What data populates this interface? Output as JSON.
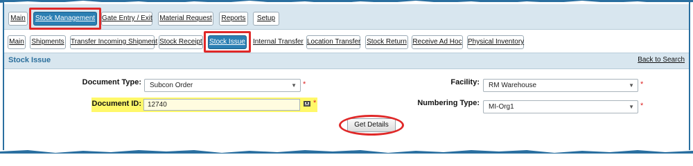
{
  "main_tabs": [
    {
      "label": "Main"
    },
    {
      "label": "Stock Management"
    },
    {
      "label": "Gate Entry / Exit"
    },
    {
      "label": "Material Request"
    },
    {
      "label": "Reports"
    },
    {
      "label": "Setup"
    }
  ],
  "sub_tabs": [
    {
      "label": "Main"
    },
    {
      "label": "Shipments"
    },
    {
      "label": "Transfer Incoming Shipment"
    },
    {
      "label": "Stock Receipt"
    },
    {
      "label": "Stock Issue"
    },
    {
      "label": "Internal Transfer"
    },
    {
      "label": "Location Transfer"
    },
    {
      "label": "Stock Return"
    },
    {
      "label": "Receive Ad Hoc"
    },
    {
      "label": "Physical Inventory"
    }
  ],
  "panel": {
    "title": "Stock Issue",
    "back_link": "Back to Search"
  },
  "form": {
    "document_type": {
      "label": "Document Type:",
      "value": "Subcon Order"
    },
    "document_id": {
      "label": "Document ID:",
      "value": "12740"
    },
    "facility": {
      "label": "Facility:",
      "value": "RM Warehouse"
    },
    "numbering_type": {
      "label": "Numbering Type:",
      "value": "MI-Org1"
    },
    "required_mark": "*",
    "get_details_label": "Get Details"
  },
  "colors": {
    "accent": "#2b7fb3",
    "highlight_annotation": "#e02828",
    "field_highlight": "#fff86a",
    "header_bg": "#d8e6ef"
  },
  "icons": {
    "lookup": "lookup-icon",
    "dropdown": "chevron-down-icon"
  }
}
